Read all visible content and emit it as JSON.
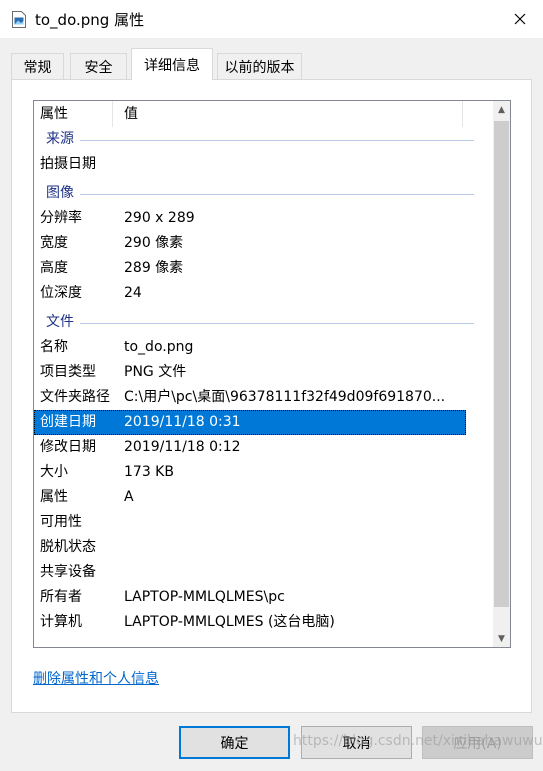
{
  "window": {
    "title": "to_do.png 属性"
  },
  "tabs": [
    {
      "label": "常规"
    },
    {
      "label": "安全"
    },
    {
      "label": "详细信息"
    },
    {
      "label": "以前的版本"
    }
  ],
  "list": {
    "headers": {
      "property": "属性",
      "value": "值"
    },
    "groups": {
      "source": "来源",
      "image": "图像",
      "file": "文件"
    },
    "rows": {
      "date_taken": {
        "k": "拍摄日期",
        "v": ""
      },
      "resolution": {
        "k": "分辨率",
        "v": "290 x 289"
      },
      "width": {
        "k": "宽度",
        "v": "290 像素"
      },
      "height": {
        "k": "高度",
        "v": "289 像素"
      },
      "bit_depth": {
        "k": "位深度",
        "v": "24"
      },
      "name": {
        "k": "名称",
        "v": "to_do.png"
      },
      "item_type": {
        "k": "项目类型",
        "v": "PNG 文件"
      },
      "folder_path": {
        "k": "文件夹路径",
        "v": "C:\\用户\\pc\\桌面\\96378111f32f49d09f691870..."
      },
      "date_created": {
        "k": "创建日期",
        "v": "2019/11/18 0:31"
      },
      "date_modified": {
        "k": "修改日期",
        "v": "2019/11/18 0:12"
      },
      "size": {
        "k": "大小",
        "v": "173 KB"
      },
      "attributes": {
        "k": "属性",
        "v": "A"
      },
      "availability": {
        "k": "可用性",
        "v": ""
      },
      "offline_status": {
        "k": "脱机状态",
        "v": ""
      },
      "shared_with": {
        "k": "共享设备",
        "v": ""
      },
      "owner": {
        "k": "所有者",
        "v": "LAPTOP-MMLQLMES\\pc"
      },
      "computer": {
        "k": "计算机",
        "v": "LAPTOP-MMLQLMES (这台电脑)"
      }
    }
  },
  "remove_link": "删除属性和个人信息",
  "buttons": {
    "ok": "确定",
    "cancel": "取消",
    "apply": "应用(A)"
  },
  "watermark": "https://blog.csdn.net/xixihahawuwu",
  "colors": {
    "selection": "#0078d7",
    "group_label": "#1e3287",
    "link": "#0066cc"
  },
  "icons": {
    "file": "png-file-icon",
    "close": "close-icon"
  }
}
